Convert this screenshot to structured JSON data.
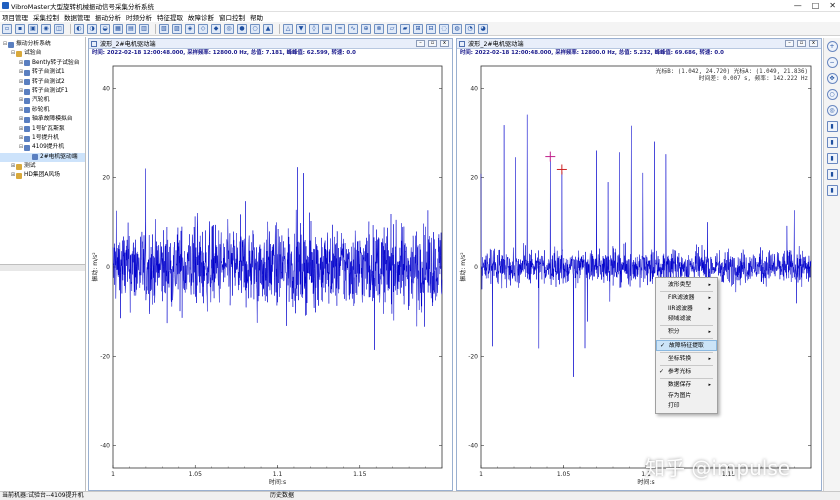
{
  "window": {
    "title": "VibroMaster大型旋转机械振动信号采集分析系统",
    "controls": [
      "—",
      "□",
      "✕"
    ]
  },
  "menu": [
    "项目管理",
    "采集控制",
    "数据管理",
    "振动分析",
    "时频分析",
    "特征提取",
    "故障诊断",
    "窗口控制",
    "帮助"
  ],
  "tree": [
    {
      "label": "振动分析系统",
      "level": 0,
      "toggle": "⊟",
      "icon": "root"
    },
    {
      "label": "试验台",
      "level": 1,
      "toggle": "⊟",
      "icon": "folder"
    },
    {
      "label": "Bently转子试验台",
      "level": 2,
      "toggle": "⊞",
      "icon": "machine"
    },
    {
      "label": "转子台测试1",
      "level": 2,
      "toggle": "⊞",
      "icon": "machine"
    },
    {
      "label": "转子台测试2",
      "level": 2,
      "toggle": "⊞",
      "icon": "machine"
    },
    {
      "label": "转子台测试F1",
      "level": 2,
      "toggle": "⊞",
      "icon": "machine"
    },
    {
      "label": "汽轮机",
      "level": 2,
      "toggle": "⊞",
      "icon": "machine"
    },
    {
      "label": "砂轮机",
      "level": 2,
      "toggle": "⊞",
      "icon": "machine"
    },
    {
      "label": "轴承故障模拟台",
      "level": 2,
      "toggle": "⊞",
      "icon": "machine"
    },
    {
      "label": "1号矿瓦斯泵",
      "level": 2,
      "toggle": "⊞",
      "icon": "machine"
    },
    {
      "label": "1号提升机",
      "level": 2,
      "toggle": "⊞",
      "icon": "machine"
    },
    {
      "label": "4109提升机",
      "level": 2,
      "toggle": "⊟",
      "icon": "machine"
    },
    {
      "label": "2#电机驱动端",
      "level": 3,
      "toggle": "",
      "icon": "sensor",
      "selected": true
    },
    {
      "label": "测试",
      "level": 1,
      "toggle": "⊞",
      "icon": "folder"
    },
    {
      "label": "HD集团A风场",
      "level": 1,
      "toggle": "⊞",
      "icon": "folder"
    }
  ],
  "left_window": {
    "caption": "波形_2#电机驱动端",
    "info": "时间: 2022-02-18 12:00:48.000, 采样频率: 12800.0 Hz, 总值: 7.181, 峰峰值: 62.599, 转速: 0.0",
    "ylabel": "振动: m/s²",
    "xlabel": "时间:s"
  },
  "right_window": {
    "caption": "波形_2#电机驱动端",
    "info": "时间: 2022-02-18 12:00:48.000, 采样频率: 12800.0 Hz, 总值: 5.232, 峰峰值: 69.686, 转速: 0.0",
    "ylabel": "振动: m/s²",
    "xlabel": "时间:s",
    "cursor_line1": "光标B: (1.042, 24.720) 光标A: (1.049, 21.836)",
    "cursor_line2": "时间差: 0.007 s, 频率: 142.222 Hz"
  },
  "chart_data": [
    {
      "type": "line",
      "xlabel": "时间:s",
      "ylabel": "振动: m/s²",
      "xlim": [
        1,
        1.2
      ],
      "ylim": [
        -45,
        45
      ],
      "xticks": [
        1,
        1.05,
        1.1,
        1.15
      ],
      "yticks": [
        -40,
        -20,
        0,
        20,
        40
      ],
      "series": [
        {
          "color": "#0000cc",
          "peak_to_peak": 62.599,
          "rms": 7.181
        }
      ]
    },
    {
      "type": "line",
      "xlabel": "时间:s",
      "ylabel": "振动: m/s²",
      "xlim": [
        1,
        1.2
      ],
      "ylim": [
        -45,
        45
      ],
      "xticks": [
        1,
        1.05,
        1.1,
        1.15
      ],
      "yticks": [
        -40,
        -20,
        0,
        20,
        40
      ],
      "series": [
        {
          "color": "#0000cc",
          "peak_to_peak": 69.686,
          "rms": 5.232
        }
      ],
      "cursors": [
        {
          "name": "B",
          "x": 1.042,
          "y": 24.72,
          "color": "#c0208a"
        },
        {
          "name": "A",
          "x": 1.049,
          "y": 21.836,
          "color": "#cc2222"
        }
      ],
      "impulse_period_s": 0.007
    }
  ],
  "context_menu": [
    {
      "label": "波形类型",
      "sub": true
    },
    {
      "sep": true
    },
    {
      "label": "FIR滤波器",
      "sub": true
    },
    {
      "label": "IIR滤波器",
      "sub": true
    },
    {
      "label": "频域滤波",
      "sub": false
    },
    {
      "sep": true
    },
    {
      "label": "积分",
      "sub": true
    },
    {
      "sep": true
    },
    {
      "label": "故障特征提取",
      "sub": false,
      "highlight": true,
      "check": "✓"
    },
    {
      "sep": true
    },
    {
      "label": "坐标转换",
      "sub": true
    },
    {
      "sep": true
    },
    {
      "label": "参考光标",
      "sub": false,
      "check": "✓"
    },
    {
      "sep": true
    },
    {
      "label": "数据保存",
      "sub": true
    },
    {
      "label": "存为图片",
      "sub": false
    },
    {
      "label": "打印",
      "sub": false
    }
  ],
  "status": {
    "left": "当前机器:试验台--4109提升机",
    "middle": "历史数据"
  },
  "watermark": "知乎 @impulse",
  "colors": {
    "signal": "#0000cc",
    "accent": "#2060c0"
  }
}
